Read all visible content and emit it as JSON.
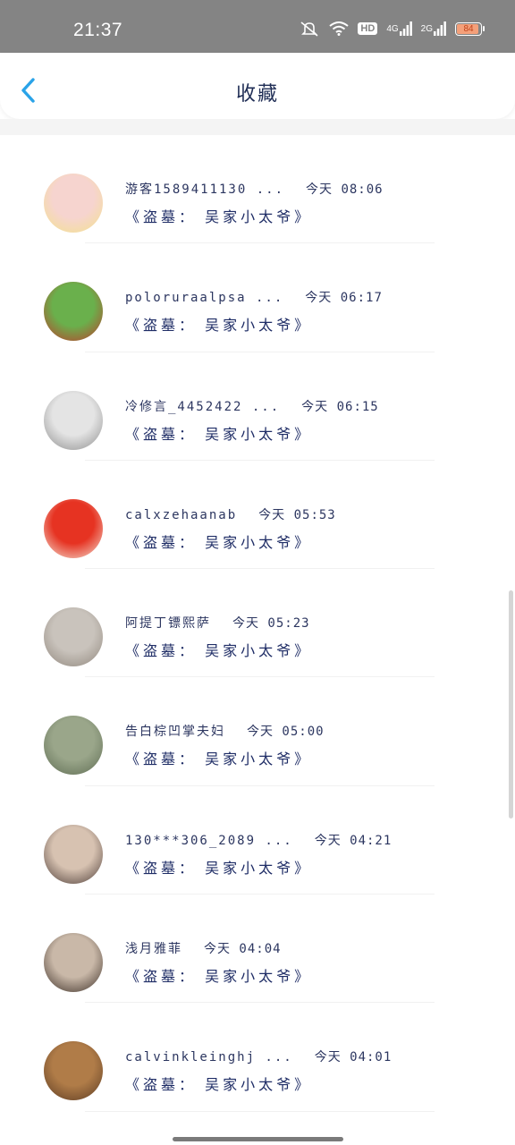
{
  "status_bar": {
    "time": "21:37",
    "hd_label": "HD",
    "net1": "4G",
    "net2": "2G",
    "battery": "84",
    "battery_level": 0.84
  },
  "header": {
    "title": "收藏",
    "back_icon": "chevron-left-icon",
    "accent_color": "#2aa3e8"
  },
  "items": [
    {
      "name": "游客1589411130 ...",
      "time": "今天 08:06",
      "title": "《盗墓： 吴家小太爷》",
      "avatar_colors": [
        "#f6d4cf",
        "#f3e28c"
      ]
    },
    {
      "name": "poloruraalpsa ...",
      "time": "今天 06:17",
      "title": "《盗墓： 吴家小太爷》",
      "avatar_colors": [
        "#6ab04c",
        "#c0392b"
      ]
    },
    {
      "name": "冷修言_4452422 ...",
      "time": "今天 06:15",
      "title": "《盗墓： 吴家小太爷》",
      "avatar_colors": [
        "#e4e4e4",
        "#8c8c8c"
      ]
    },
    {
      "name": "calxzehaanab",
      "time": "今天 05:53",
      "title": "《盗墓： 吴家小太爷》",
      "avatar_colors": [
        "#e63322",
        "#f4e6d8"
      ]
    },
    {
      "name": "阿提丁镖熙萨",
      "time": "今天 05:23",
      "title": "《盗墓： 吴家小太爷》",
      "avatar_colors": [
        "#c9c3bc",
        "#8f867c"
      ]
    },
    {
      "name": "告白棕凹掌夫妇",
      "time": "今天 05:00",
      "title": "《盗墓： 吴家小太爷》",
      "avatar_colors": [
        "#9aa68a",
        "#5d6b52"
      ]
    },
    {
      "name": "130***306_2089 ...",
      "time": "今天 04:21",
      "title": "《盗墓： 吴家小太爷》",
      "avatar_colors": [
        "#d7c2b1",
        "#4b3b36"
      ]
    },
    {
      "name": "浅月雅菲",
      "time": "今天 04:04",
      "title": "《盗墓： 吴家小太爷》",
      "avatar_colors": [
        "#c9b8a8",
        "#3a2d25"
      ]
    },
    {
      "name": "calvinkleinghj ...",
      "time": "今天 04:01",
      "title": "《盗墓： 吴家小太爷》",
      "avatar_colors": [
        "#b07c48",
        "#5a3a22"
      ]
    }
  ]
}
